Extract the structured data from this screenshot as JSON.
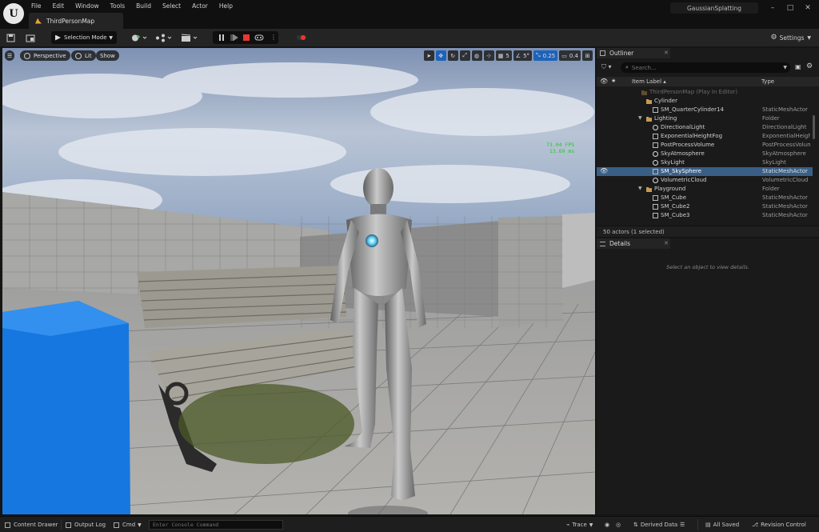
{
  "window": {
    "menu": [
      "File",
      "Edit",
      "Window",
      "Tools",
      "Build",
      "Select",
      "Actor",
      "Help"
    ],
    "map_tab": "ThirdPersonMap",
    "project": "GaussianSplatting"
  },
  "toolbar": {
    "selection_mode": "Selection Mode",
    "settings": "Settings"
  },
  "viewport": {
    "perspective": "Perspective",
    "lit": "Lit",
    "show": "Show",
    "grid_snap": "5",
    "angle_snap": "5°",
    "scale_snap": "0.25",
    "camera_speed": "0.4",
    "fps": "73.04 FPS",
    "ms": "13.69 ms"
  },
  "outliner": {
    "tab": "Outliner",
    "search_placeholder": "Search...",
    "col_label": "Item Label ▴",
    "col_type": "Type",
    "rows": [
      {
        "label": "ThirdPersonMap (Play In Editor)",
        "type": ""
      },
      {
        "label": "Cylinder",
        "type": ""
      },
      {
        "label": "SM_QuarterCylinder14",
        "type": "StaticMeshActor"
      },
      {
        "label": "Lighting",
        "type": "Folder"
      },
      {
        "label": "DirectionalLight",
        "type": "DirectionalLight"
      },
      {
        "label": "ExponentialHeightFog",
        "type": "ExponentialHeightF"
      },
      {
        "label": "PostProcessVolume",
        "type": "PostProcessVolum"
      },
      {
        "label": "SkyAtmosphere",
        "type": "SkyAtmosphere"
      },
      {
        "label": "SkyLight",
        "type": "SkyLight"
      },
      {
        "label": "SM_SkySphere",
        "type": "StaticMeshActor"
      },
      {
        "label": "VolumetricCloud",
        "type": "VolumetricCloud"
      },
      {
        "label": "Playground",
        "type": "Folder"
      },
      {
        "label": "SM_Cube",
        "type": "StaticMeshActor"
      },
      {
        "label": "SM_Cube2",
        "type": "StaticMeshActor"
      },
      {
        "label": "SM_Cube3",
        "type": "StaticMeshActor"
      }
    ],
    "footer": "50 actors (1 selected)"
  },
  "details": {
    "tab": "Details",
    "empty": "Select an object to view details."
  },
  "statusbar": {
    "content_drawer": "Content Drawer",
    "output_log": "Output Log",
    "cmd": "Cmd",
    "console_placeholder": "Enter Console Command",
    "trace": "Trace",
    "derived_data": "Derived Data",
    "all_saved": "All Saved",
    "revision_control": "Revision Control"
  }
}
